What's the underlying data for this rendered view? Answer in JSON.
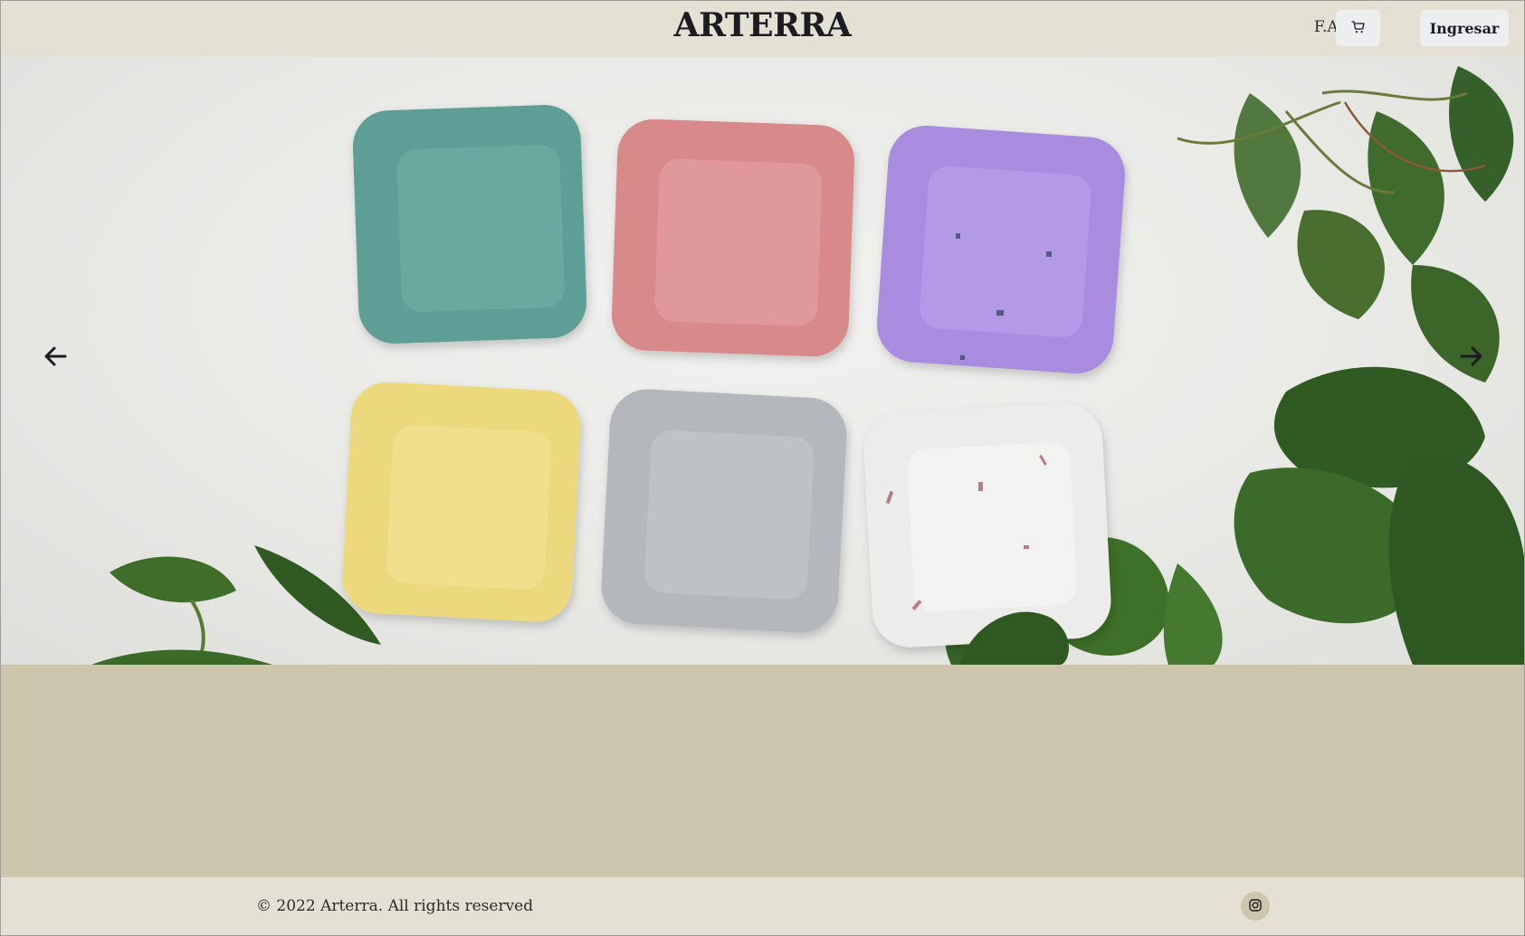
{
  "header": {
    "brand": "ARTERRA",
    "faq_label": "F.A.Q",
    "cart_icon": "cart-icon",
    "login_label": "Ingresar"
  },
  "carousel": {
    "prev_icon": "arrow-left-icon",
    "next_icon": "arrow-right-icon",
    "slide_image": "six-colored-square-ceramic-dishes-with-plants"
  },
  "footer": {
    "copyright": "© 2022 Arterra. All rights reserved",
    "social_icon": "instagram-icon"
  },
  "colors": {
    "header_bg": "#e4e1d4",
    "body_bg": "#cdc6ad",
    "button_bg": "#edeef0",
    "text": "#1b1b22"
  }
}
